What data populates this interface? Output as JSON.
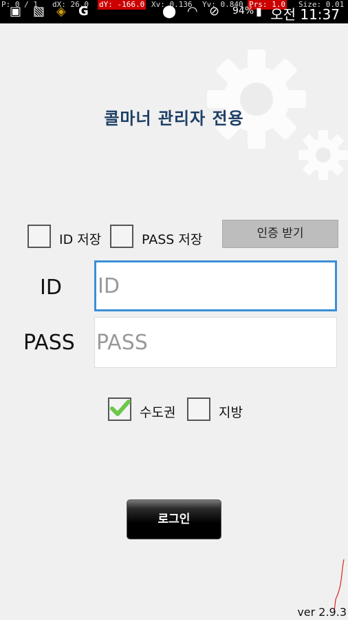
{
  "status_bar": {
    "debug": {
      "p": "P: 0 / 1",
      "dx": "dX: 26.0",
      "dy": "dY: -166.0",
      "xv": "Xv: 0.136",
      "yv": "Yv: 0.840",
      "prs": "Prs: 1.0",
      "size": "Size: 0.01"
    },
    "icons": [
      "screenshot-icon",
      "image-icon",
      "app-icon",
      "google-icon",
      "location-icon",
      "wifi-icon",
      "no-sound-icon"
    ],
    "battery": "94%",
    "time": "오전 11:37",
    "colors": {
      "background": "#000000",
      "debug_highlight": "#cc0000"
    }
  },
  "header": {
    "title": "콜마너 관리자 전용"
  },
  "options": {
    "save_id_label": "ID 저장",
    "save_id_checked": false,
    "save_pass_label": "PASS 저장",
    "save_pass_checked": false,
    "auth_button_label": "인증 받기"
  },
  "form": {
    "id_label": "ID",
    "id_placeholder": "ID",
    "id_value": "",
    "pass_label": "PASS",
    "pass_placeholder": "PASS",
    "pass_value": ""
  },
  "region": {
    "capital_label": "수도권",
    "capital_checked": true,
    "local_label": "지방",
    "local_checked": false
  },
  "login": {
    "button_label": "로그인"
  },
  "footer": {
    "version": "ver 2.9.3"
  },
  "colors": {
    "title": "#1e3f66",
    "focus_border": "#3a8fd6",
    "checkmark": "#6cc84a",
    "auth_button": "#bdbdbd"
  }
}
